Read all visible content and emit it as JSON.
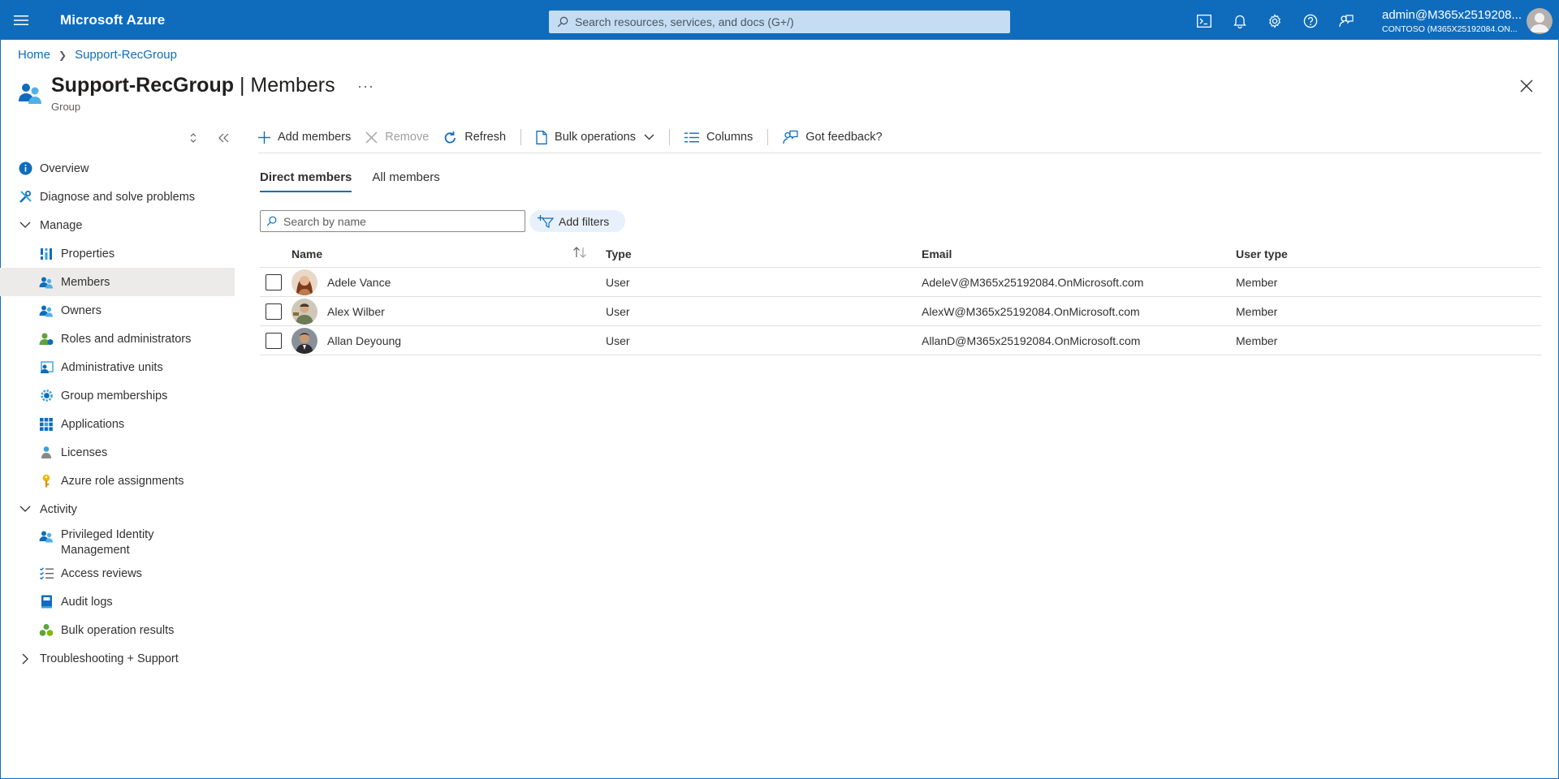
{
  "topbar": {
    "brand": "Microsoft Azure",
    "search_placeholder": "Search resources, services, and docs (G+/)",
    "account_name": "admin@M365x2519208...",
    "account_tenant": "CONTOSO (M365X25192084.ON...",
    "icons": [
      "menu-icon",
      "cloud-shell-icon",
      "notifications-icon",
      "settings-icon",
      "help-icon",
      "feedback-icon",
      "avatar"
    ]
  },
  "breadcrumb": {
    "home": "Home",
    "current": "Support-RecGroup"
  },
  "header": {
    "group_name": "Support-RecGroup",
    "separator": " | ",
    "section": "Members",
    "subtitle": "Group",
    "more": "···"
  },
  "sidebar": {
    "items": [
      {
        "label": "Overview",
        "icon": "info-icon"
      },
      {
        "label": "Diagnose and solve problems",
        "icon": "wrench-icon"
      },
      {
        "label": "Manage",
        "icon": "chevron-down-icon"
      },
      {
        "label": "Properties",
        "icon": "properties-icon"
      },
      {
        "label": "Members",
        "icon": "members-icon"
      },
      {
        "label": "Owners",
        "icon": "owners-icon"
      },
      {
        "label": "Roles and administrators",
        "icon": "roles-icon"
      },
      {
        "label": "Administrative units",
        "icon": "admin-units-icon"
      },
      {
        "label": "Group memberships",
        "icon": "gear-icon"
      },
      {
        "label": "Applications",
        "icon": "grid-icon"
      },
      {
        "label": "Licenses",
        "icon": "license-icon"
      },
      {
        "label": "Azure role assignments",
        "icon": "key-icon"
      },
      {
        "label": "Activity",
        "icon": "chevron-down-icon"
      },
      {
        "label": "Privileged Identity Management",
        "icon": "pim-icon"
      },
      {
        "label": "Access reviews",
        "icon": "checklist-icon"
      },
      {
        "label": "Audit logs",
        "icon": "book-icon"
      },
      {
        "label": "Bulk operation results",
        "icon": "bulk-icon"
      },
      {
        "label": "Troubleshooting + Support",
        "icon": "chevron-right-icon"
      }
    ]
  },
  "toolbar": {
    "add_members": "Add members",
    "remove": "Remove",
    "refresh": "Refresh",
    "bulk_operations": "Bulk operations",
    "columns": "Columns",
    "feedback": "Got feedback?"
  },
  "tabs": {
    "direct": "Direct members",
    "all": "All members"
  },
  "filters": {
    "search_placeholder": "Search by name",
    "add_filters": "Add filters"
  },
  "table": {
    "headers": {
      "name": "Name",
      "type": "Type",
      "email": "Email",
      "user_type": "User type"
    },
    "rows": [
      {
        "name": "Adele Vance",
        "type": "User",
        "email": "AdeleV@M365x25192084.OnMicrosoft.com",
        "user_type": "Member"
      },
      {
        "name": "Alex Wilber",
        "type": "User",
        "email": "AlexW@M365x25192084.OnMicrosoft.com",
        "user_type": "Member"
      },
      {
        "name": "Allan Deyoung",
        "type": "User",
        "email": "AllanD@M365x25192084.OnMicrosoft.com",
        "user_type": "Member"
      }
    ]
  },
  "colors": {
    "accent": "#0f6cbd",
    "selected_nav": "#edebe9",
    "filter_pill": "#e8f1fb"
  }
}
